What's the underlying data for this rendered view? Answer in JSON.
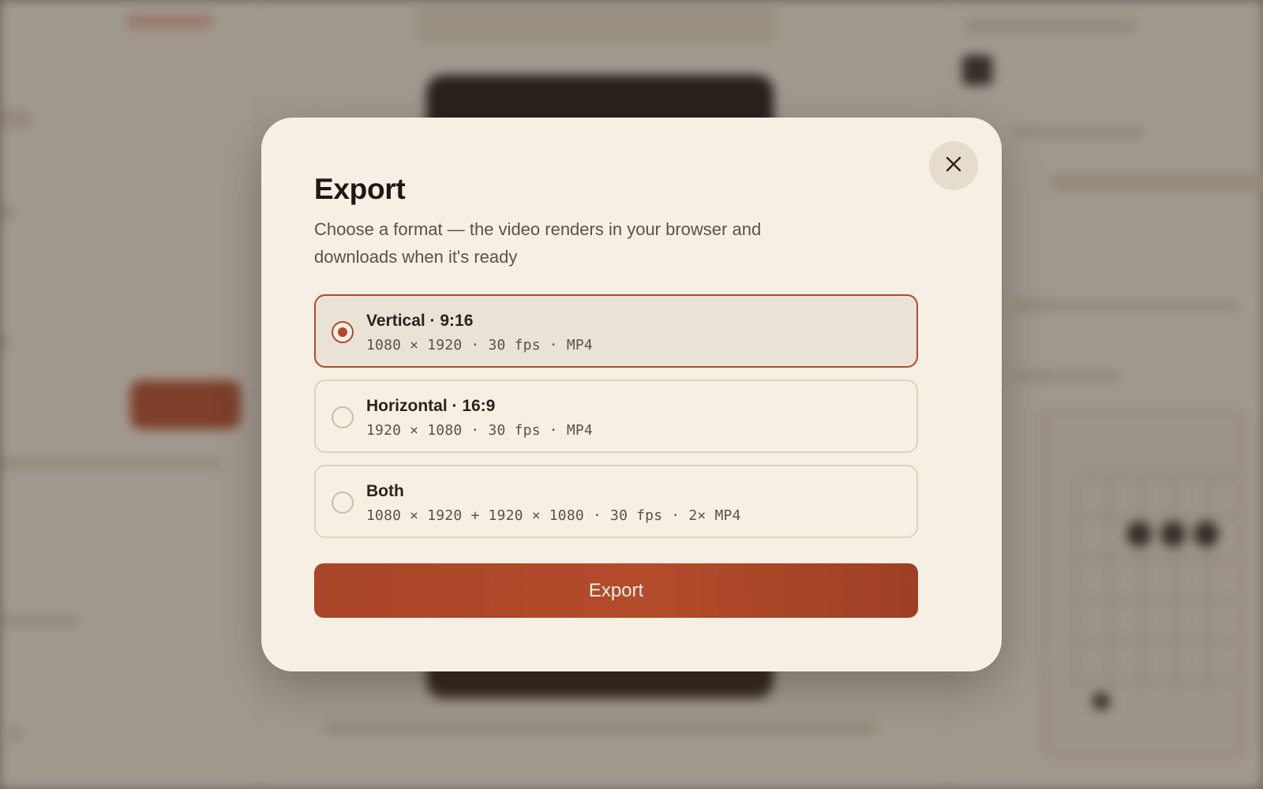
{
  "modal": {
    "title": "Export",
    "description": "Choose a format — the video renders in your browser and downloads when it's ready",
    "options": [
      {
        "label": "Vertical · 9:16",
        "spec": "1080 × 1920 · 30 fps · MP4",
        "selected": true
      },
      {
        "label": "Horizontal · 16:9",
        "spec": "1920 × 1080 · 30 fps · MP4",
        "selected": false
      },
      {
        "label": "Both",
        "spec": "1080 × 1920 + 1920 × 1080 · 30 fps · 2× MP4",
        "selected": false
      }
    ],
    "export_label": "Export",
    "close_icon": "close-icon"
  },
  "colors": {
    "accent": "#b3482a",
    "modal_bg": "#f6f0e4",
    "selected_bg": "#e9e3d7"
  }
}
